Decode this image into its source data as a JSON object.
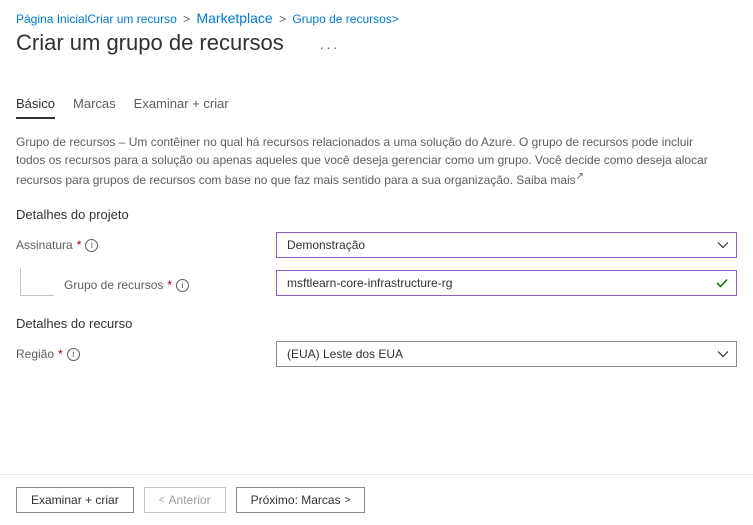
{
  "breadcrumb": {
    "home": "Página Inicial",
    "create": "Criar um recurso",
    "marketplace": "Marketplace",
    "current": "Grupo de recursos"
  },
  "page": {
    "title": "Criar um grupo de recursos"
  },
  "tabs": {
    "basic": "Básico",
    "tags": "Marcas",
    "review": "Examinar + criar"
  },
  "description": {
    "text": "Grupo de recursos – Um contêiner no qual há recursos relacionados a uma solução do Azure. O grupo de recursos pode incluir todos os recursos para a solução ou apenas aqueles que você deseja gerenciar como um grupo. Você decide como deseja alocar recursos para grupos de recursos com base no que faz mais sentido para a sua organização.",
    "learn_more": "Saiba mais"
  },
  "sections": {
    "project_details": "Detalhes do projeto",
    "resource_details": "Detalhes do recurso"
  },
  "fields": {
    "subscription_label": "Assinatura",
    "subscription_value": "Demonstração",
    "resource_group_label": "Grupo de recursos",
    "resource_group_value": "msftlearn-core-infrastructure-rg",
    "region_label": "Região",
    "region_value": "(EUA) Leste dos EUA"
  },
  "footer": {
    "review": "Examinar + criar",
    "previous": "Anterior",
    "next": "Próximo: Marcas"
  },
  "glyphs": {
    "star": "*",
    "info": "i",
    "chev_left": "<",
    "chev_right": ">",
    "ext": "↗"
  }
}
